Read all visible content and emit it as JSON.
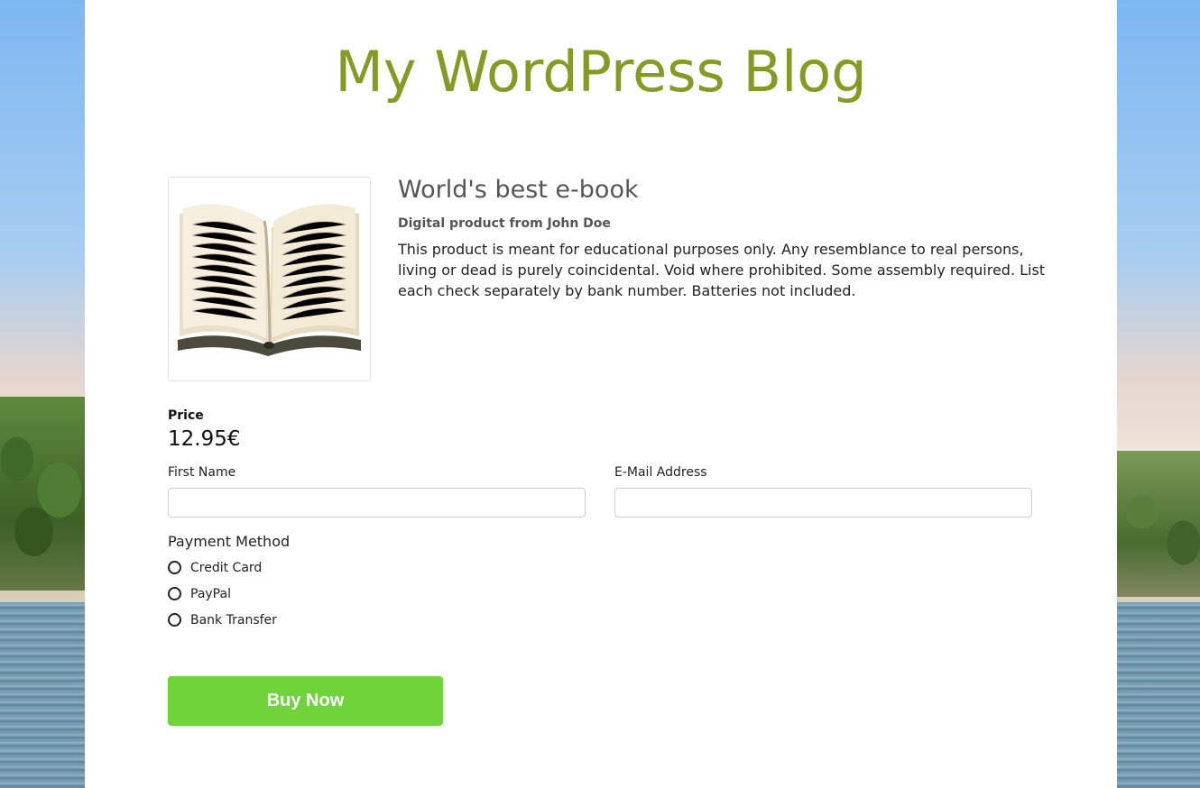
{
  "site": {
    "title": "My WordPress Blog"
  },
  "product": {
    "image_icon": "open-book-image",
    "title": "World's best e-book",
    "subtitle": "Digital product from John Doe",
    "description": "This product is meant for educational purposes only. Any resemblance to real persons, living or dead is purely coincidental. Void where prohibited. Some assembly required. List each check separately by bank number. Batteries not included."
  },
  "price": {
    "label": "Price",
    "value": "12.95€"
  },
  "form": {
    "first_name": {
      "label": "First Name",
      "value": "",
      "placeholder": ""
    },
    "email": {
      "label": "E-Mail Address",
      "value": "",
      "placeholder": ""
    },
    "payment": {
      "title": "Payment Method",
      "options": [
        "Credit Card",
        "PayPal",
        "Bank Transfer"
      ]
    },
    "buy_label": "Buy Now"
  },
  "colors": {
    "title": "#849b24",
    "button": "#6fd339"
  }
}
